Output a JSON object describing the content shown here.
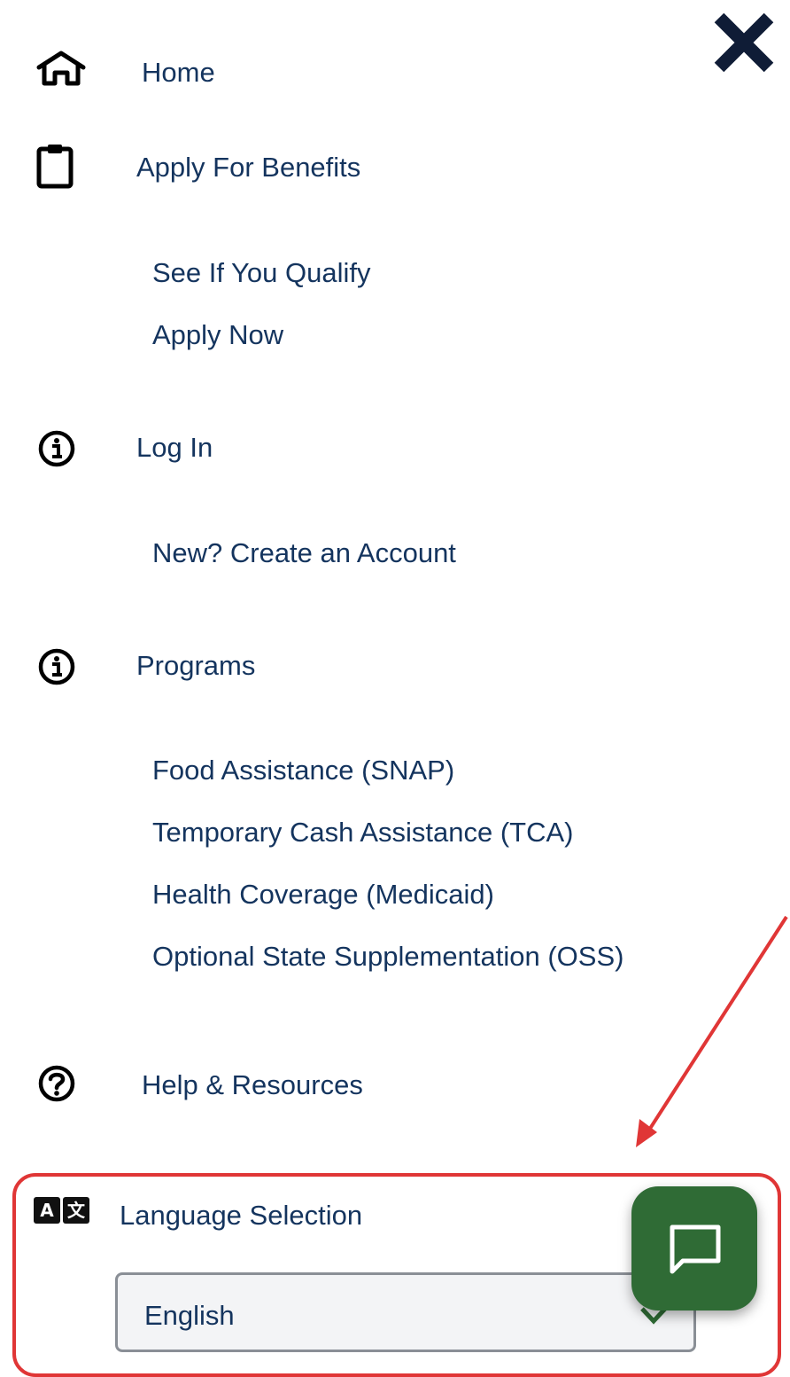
{
  "menu": {
    "close_icon": "close-icon",
    "items": [
      {
        "label": "Home",
        "icon": "home-icon"
      },
      {
        "label": "Apply For Benefits",
        "icon": "clipboard-icon",
        "children": [
          "See If You Qualify",
          "Apply Now"
        ]
      },
      {
        "label": "Log In",
        "icon": "info-icon",
        "children": [
          "New? Create an Account"
        ]
      },
      {
        "label": "Programs",
        "icon": "info-icon",
        "children": [
          "Food Assistance (SNAP)",
          "Temporary Cash Assistance (TCA)",
          "Health Coverage (Medicaid)",
          "Optional State Supplementation (OSS)"
        ]
      },
      {
        "label": "Help & Resources",
        "icon": "help-icon"
      }
    ]
  },
  "language": {
    "label": "Language Selection",
    "icon": "translate-icon",
    "badge_a": "A",
    "badge_b": "文",
    "selected": "English"
  },
  "chat": {
    "icon": "chat-icon"
  },
  "colors": {
    "nav_text": "#14345e",
    "highlight": "#e03636",
    "chat_button": "#2f6b35"
  }
}
